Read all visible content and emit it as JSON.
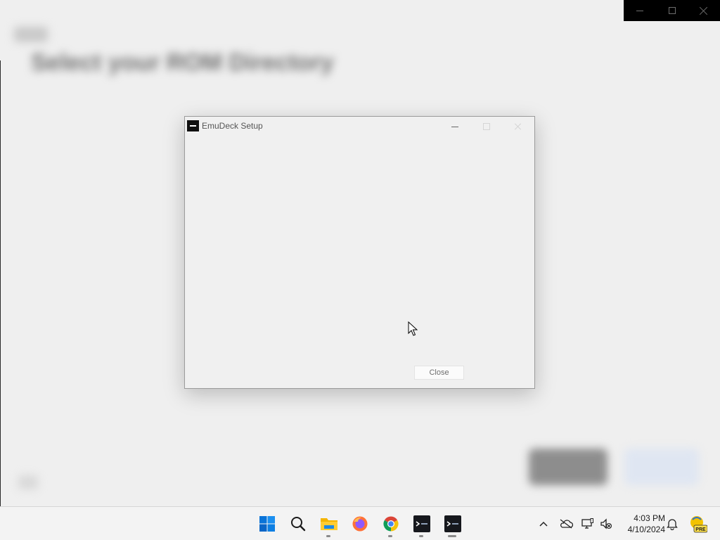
{
  "dialog": {
    "title": "EmuDeck Setup",
    "close_label": "Close"
  },
  "background": {
    "title": "Select your ROM Directory"
  },
  "taskbar": {
    "apps": [
      {
        "name": "start",
        "icon": "windows-start-icon"
      },
      {
        "name": "search",
        "icon": "search-icon"
      },
      {
        "name": "file-explorer",
        "icon": "folder-icon"
      },
      {
        "name": "firefox",
        "icon": "firefox-icon"
      },
      {
        "name": "chrome",
        "icon": "chrome-icon"
      },
      {
        "name": "emudeck-1",
        "icon": "emudeck-icon"
      },
      {
        "name": "emudeck-2",
        "icon": "emudeck-icon"
      }
    ],
    "time": "4:03 PM",
    "date": "4/10/2024",
    "tray_badge": "PRE"
  },
  "colors": {
    "background": "#efefef",
    "taskbar": "#f3f3f3",
    "start_blue": "#0078d4"
  }
}
